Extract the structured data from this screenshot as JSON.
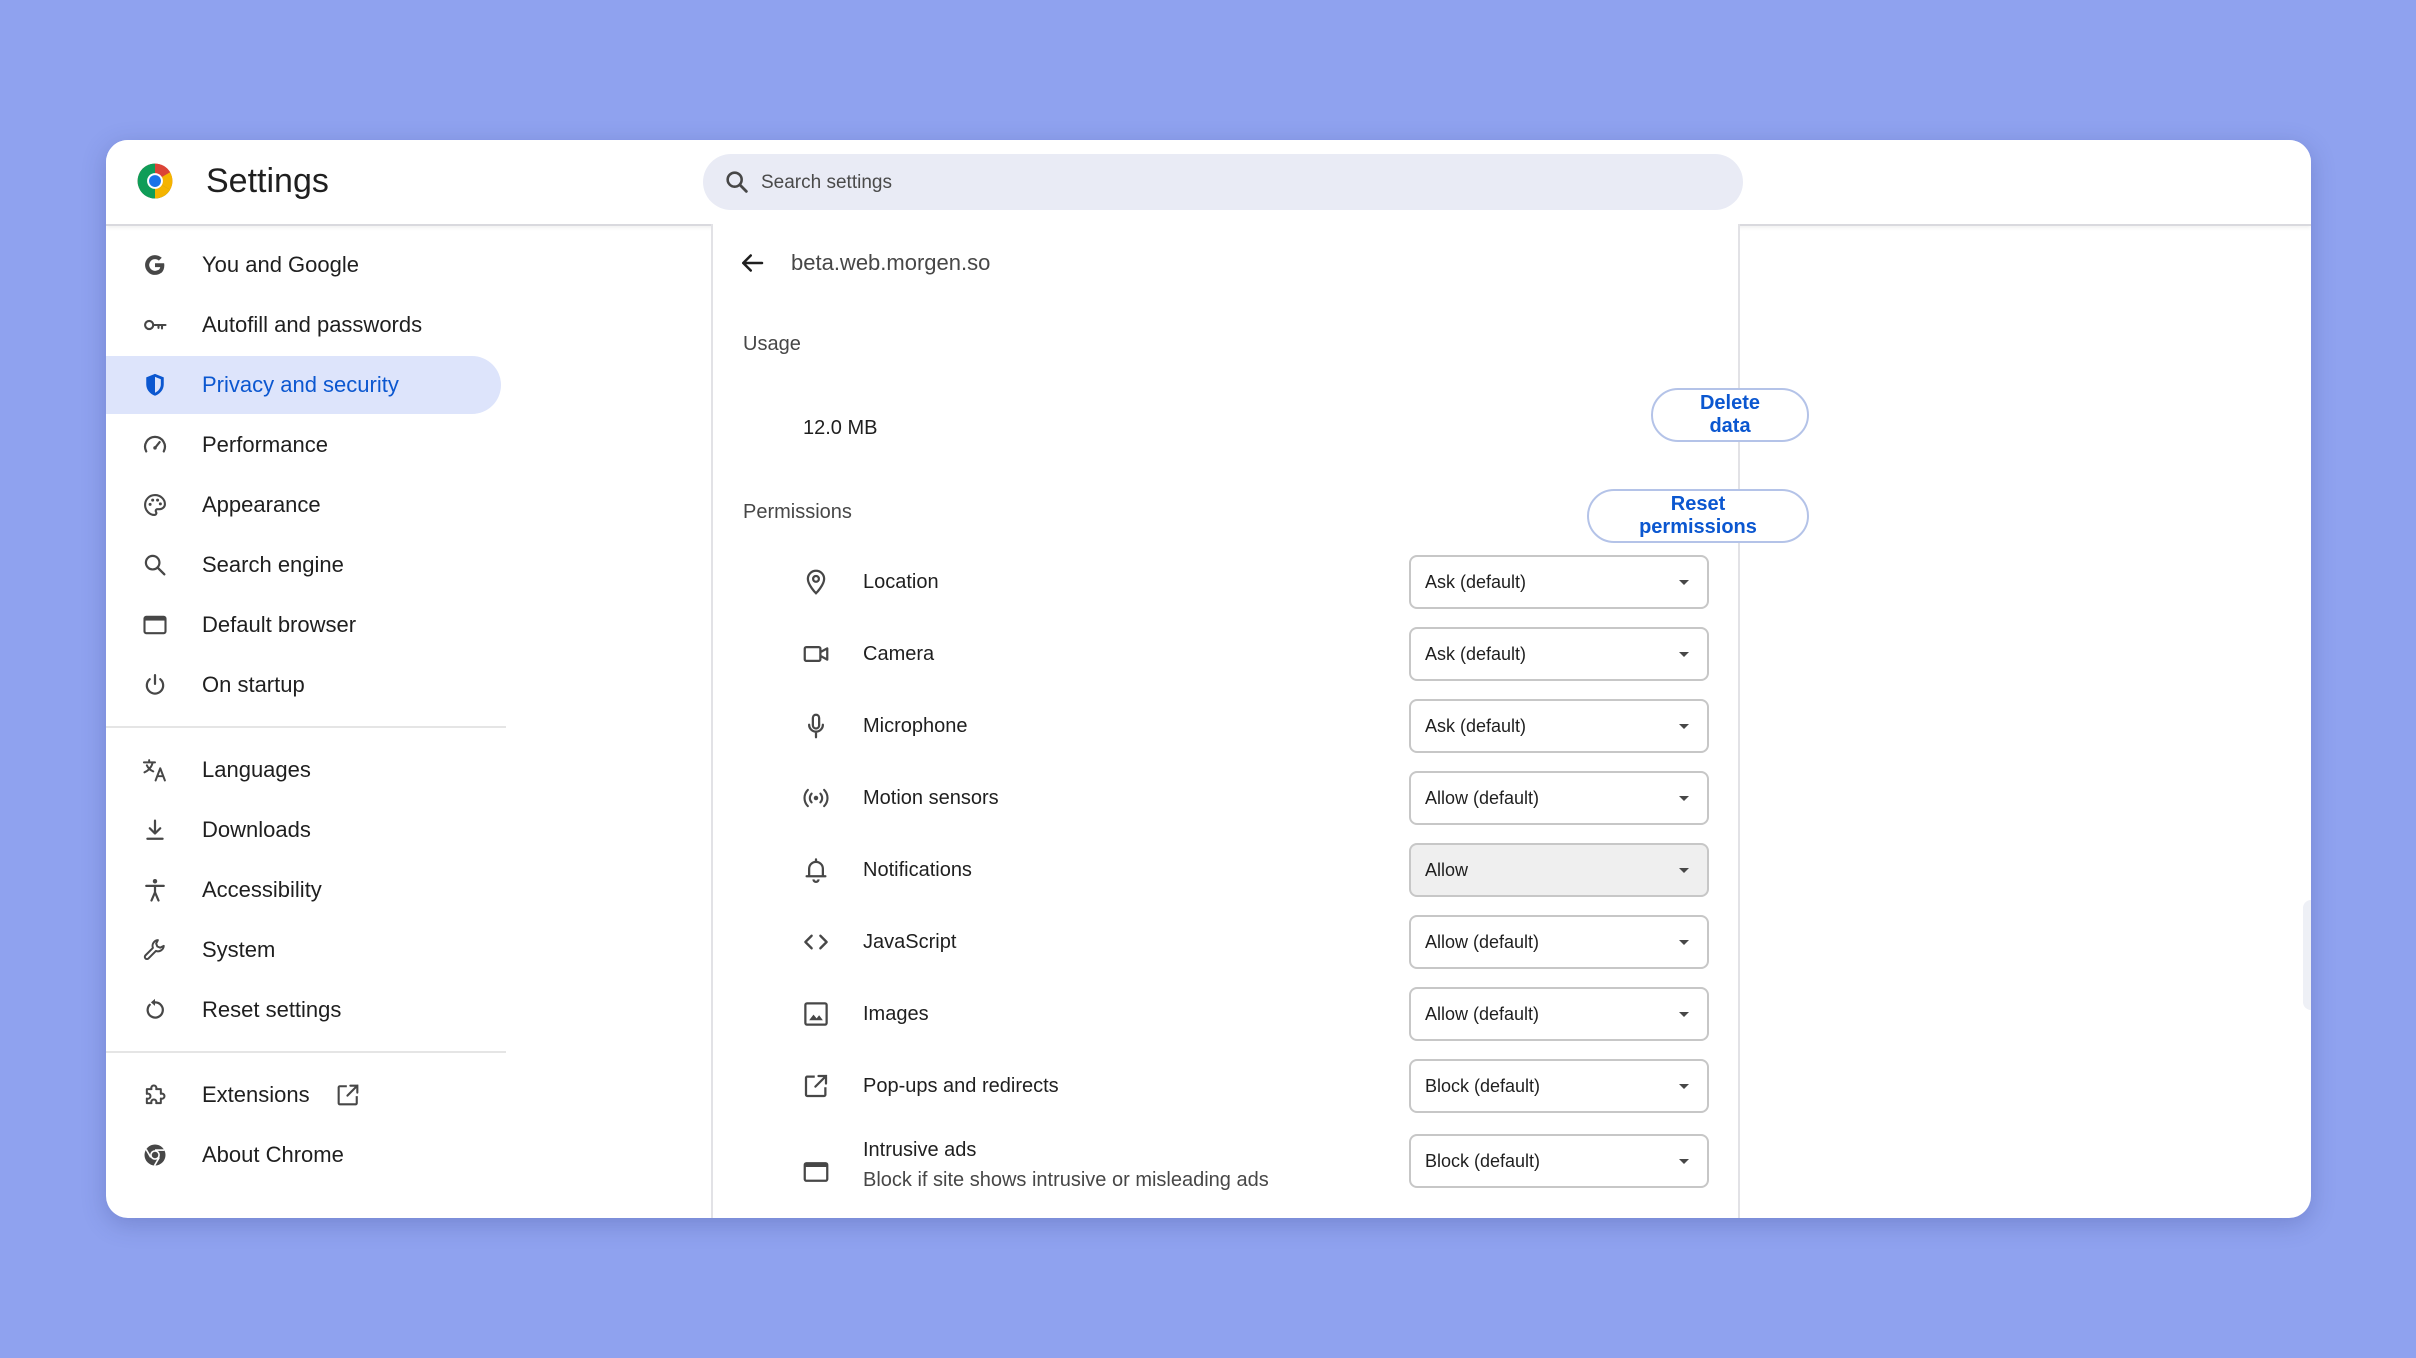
{
  "app": {
    "title": "Settings"
  },
  "search": {
    "placeholder": "Search settings"
  },
  "sidebar": {
    "items": [
      {
        "label": "You and Google",
        "icon": "google-g-icon"
      },
      {
        "label": "Autofill and passwords",
        "icon": "key-icon"
      },
      {
        "label": "Privacy and security",
        "icon": "shield-icon",
        "active": true
      },
      {
        "label": "Performance",
        "icon": "speedometer-icon"
      },
      {
        "label": "Appearance",
        "icon": "palette-icon"
      },
      {
        "label": "Search engine",
        "icon": "search-icon"
      },
      {
        "label": "Default browser",
        "icon": "browser-window-icon"
      },
      {
        "label": "On startup",
        "icon": "power-icon"
      },
      {
        "label": "Languages",
        "icon": "translate-icon"
      },
      {
        "label": "Downloads",
        "icon": "download-icon"
      },
      {
        "label": "Accessibility",
        "icon": "accessibility-icon"
      },
      {
        "label": "System",
        "icon": "wrench-icon"
      },
      {
        "label": "Reset settings",
        "icon": "reset-icon"
      },
      {
        "label": "Extensions",
        "icon": "puzzle-icon"
      },
      {
        "label": "About Chrome",
        "icon": "chrome-icon"
      }
    ]
  },
  "site": {
    "name": "beta.web.morgen.so"
  },
  "usage": {
    "title": "Usage",
    "value": "12.0 MB",
    "delete_label": "Delete data"
  },
  "permissions": {
    "title": "Permissions",
    "reset_label": "Reset permissions",
    "items": [
      {
        "label": "Location",
        "icon": "location-pin-icon",
        "value": "Ask (default)"
      },
      {
        "label": "Camera",
        "icon": "camera-icon",
        "value": "Ask (default)"
      },
      {
        "label": "Microphone",
        "icon": "microphone-icon",
        "value": "Ask (default)"
      },
      {
        "label": "Motion sensors",
        "icon": "motion-sensor-icon",
        "value": "Allow (default)"
      },
      {
        "label": "Notifications",
        "icon": "bell-icon",
        "value": "Allow"
      },
      {
        "label": "JavaScript",
        "icon": "code-icon",
        "value": "Allow (default)"
      },
      {
        "label": "Images",
        "icon": "image-icon",
        "value": "Allow (default)"
      },
      {
        "label": "Pop-ups and redirects",
        "icon": "open-external-icon",
        "value": "Block (default)"
      },
      {
        "label": "Intrusive ads",
        "sublabel": "Block if site shows intrusive or misleading ads",
        "icon": "ad-window-icon",
        "value": "Block (default)"
      }
    ]
  },
  "colors": {
    "background": "#8fa2ef",
    "accent": "#0b57d0",
    "active_nav": "#dde4fb",
    "search_bg": "#e9ebf5"
  }
}
